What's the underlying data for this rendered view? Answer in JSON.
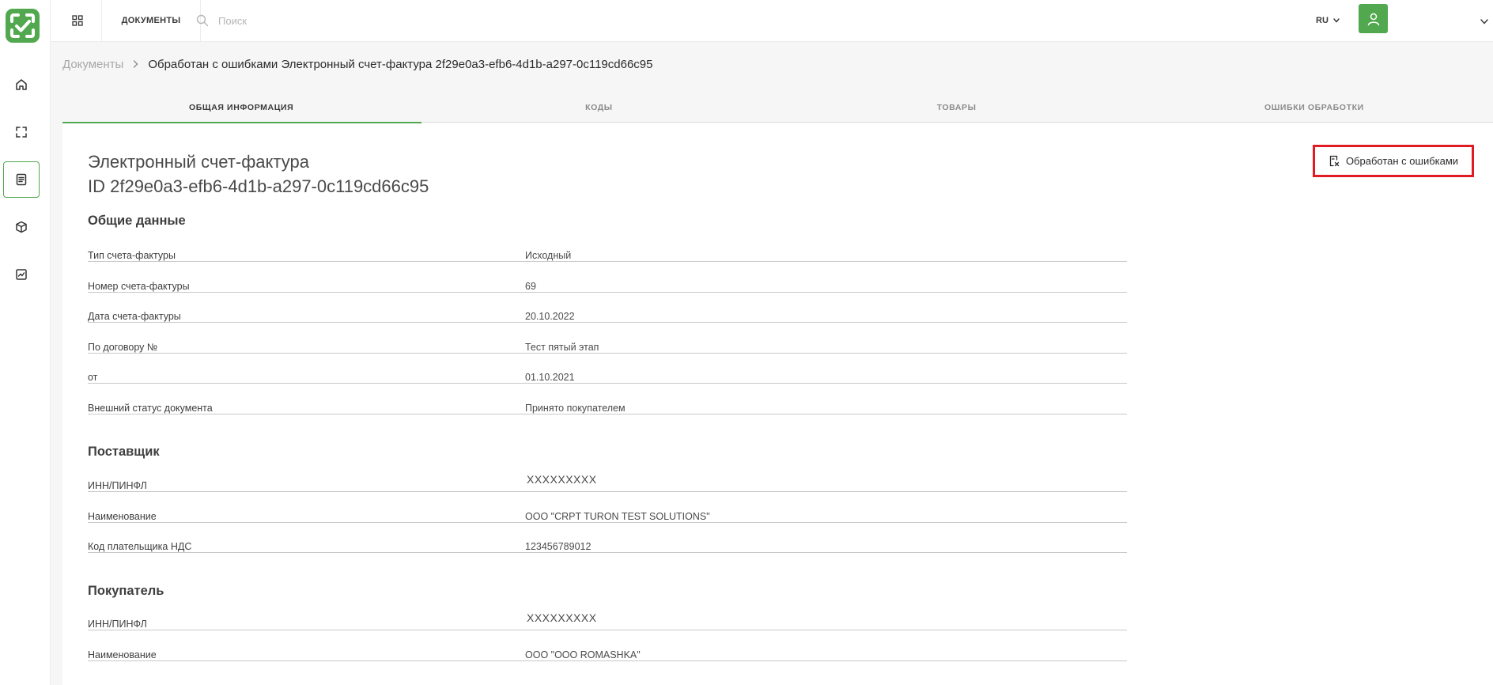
{
  "topbar": {
    "section_label": "ДОКУМЕНТЫ",
    "search_placeholder": "Поиск",
    "language": "RU"
  },
  "breadcrumb": {
    "root": "Документы",
    "current": "Обработан с ошибками Электронный счет-фактура 2f29e0a3-efb6-4d1b-a297-0c119cd66c95"
  },
  "tabs": [
    {
      "label": "ОБЩАЯ ИНФОРМАЦИЯ",
      "active": true
    },
    {
      "label": "КОДЫ",
      "active": false
    },
    {
      "label": "ТОВАРЫ",
      "active": false
    },
    {
      "label": "ОШИБКИ ОБРАБОТКИ",
      "active": false
    }
  ],
  "document": {
    "title": "Электронный счет-фактура",
    "id": "ID 2f29e0a3-efb6-4d1b-a297-0c119cd66c95",
    "status": "Обработан с ошибками"
  },
  "general": {
    "title": "Общие данные",
    "rows": [
      {
        "label": "Тип счета-фактуры",
        "value": "Исходный"
      },
      {
        "label": "Номер счета-фактуры",
        "value": "69"
      },
      {
        "label": "Дата счета-фактуры",
        "value": "20.10.2022"
      },
      {
        "label": "По договору №",
        "value": "Тест пятый этап"
      },
      {
        "label": "от",
        "value": "01.10.2021"
      },
      {
        "label": "Внешний статус документа",
        "value": "Принято покупателем"
      }
    ]
  },
  "supplier": {
    "title": "Поставщик",
    "rows": [
      {
        "label": "ИНН/ПИНФЛ",
        "value": "XXXXXXXXX"
      },
      {
        "label": "Наименование",
        "value": "ООО \"CRPT TURON TEST SOLUTIONS\""
      },
      {
        "label": "Код плательщика НДС",
        "value": "123456789012"
      }
    ]
  },
  "buyer": {
    "title": "Покупатель",
    "rows": [
      {
        "label": "ИНН/ПИНФЛ",
        "value": "XXXXXXXXX"
      },
      {
        "label": "Наименование",
        "value": "ООО \"ООО ROMASHKA\""
      }
    ]
  },
  "colors": {
    "accent": "#51a84e",
    "highlight": "#e01b24"
  },
  "icons": {
    "sidebar": [
      "home-icon",
      "scan-icon",
      "document-icon",
      "box-icon",
      "chart-icon"
    ]
  }
}
